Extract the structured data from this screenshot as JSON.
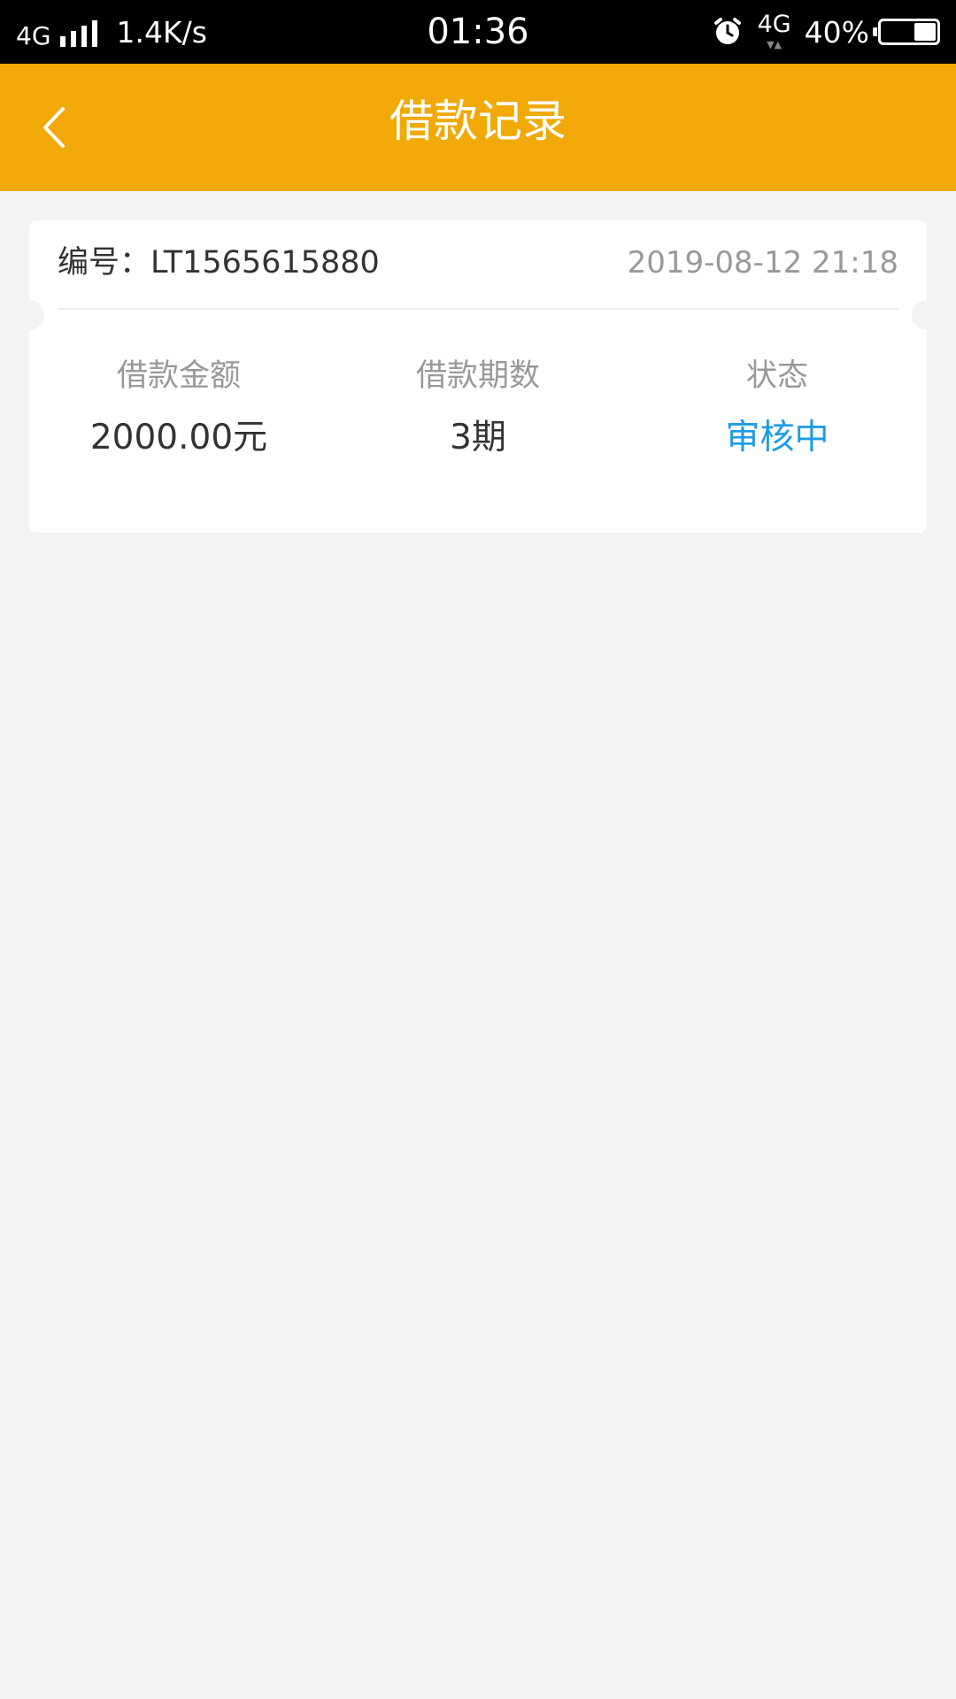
{
  "status_bar": {
    "network_left": "4G",
    "speed": "1.4K/s",
    "time": "01:36",
    "network_right": "4G",
    "battery_percent": "40%",
    "battery_level": 0.4
  },
  "header": {
    "title": "借款记录",
    "background_color": "#f0a906"
  },
  "record": {
    "number_label": "编号：",
    "number_value": "LT1565615880",
    "date": "2019-08-12 21:18",
    "stats": [
      {
        "label": "借款金额",
        "value": "2000.00元"
      },
      {
        "label": "借款期数",
        "value": "3期"
      },
      {
        "label": "状态",
        "value": "审核中"
      }
    ],
    "status_color": "#1e9be4"
  },
  "icons": {
    "back": "chevron-left-icon",
    "alarm": "alarm-clock-icon",
    "signal": "signal-bars-icon",
    "battery": "battery-icon"
  }
}
